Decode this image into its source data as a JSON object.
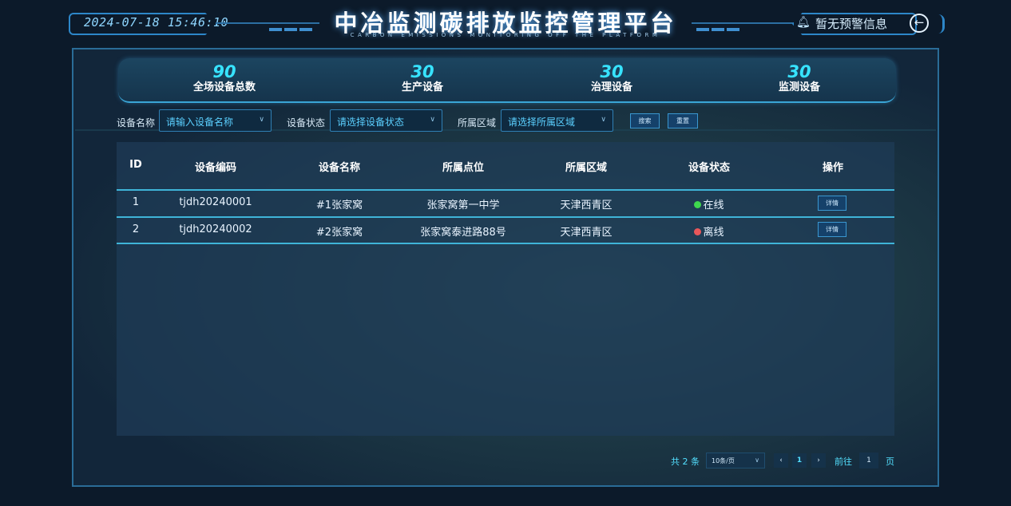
{
  "header": {
    "datetime": "2024-07-18 15:46:10",
    "title": "中冶监测碳排放监控管理平台",
    "subtitle": "CARBON EMISSIONS MONITORING OFF THE PLATFORM",
    "alert": "暂无预警信息",
    "icons": {
      "alert": "bell-icon",
      "back": "back-arrow-icon"
    }
  },
  "stats": [
    {
      "value": "90",
      "label": "全场设备总数"
    },
    {
      "value": "30",
      "label": "生产设备"
    },
    {
      "value": "30",
      "label": "治理设备"
    },
    {
      "value": "30",
      "label": "监测设备"
    }
  ],
  "filters": {
    "name_label": "设备名称",
    "name_placeholder": "请输入设备名称",
    "status_label": "设备状态",
    "status_placeholder": "请选择设备状态",
    "area_label": "所属区域",
    "area_placeholder": "请选择所属区域",
    "search_label": "搜索",
    "reset_label": "重置"
  },
  "table": {
    "headers": [
      "ID",
      "设备编码",
      "设备名称",
      "所属点位",
      "所属区域",
      "设备状态",
      "操作"
    ],
    "rows": [
      {
        "id": "1",
        "code": "tjdh20240001",
        "name": "#1张家窝",
        "point": "张家窝第一中学",
        "area": "天津西青区",
        "status": "在线",
        "action": "详情"
      },
      {
        "id": "2",
        "code": "tjdh20240002",
        "name": "#2张家窝",
        "point": "张家窝泰进路88号",
        "area": "天津西青区",
        "status": "离线",
        "action": "详情"
      }
    ]
  },
  "status_colors": {
    "online": "#3ed84e",
    "offline": "#e8575a"
  },
  "pagination": {
    "total": "共 2 条",
    "page_size": "10条/页",
    "prev": "‹",
    "current": "1",
    "next": "›",
    "goto_label": "前往",
    "goto_value": "1",
    "page_suffix": "页"
  }
}
